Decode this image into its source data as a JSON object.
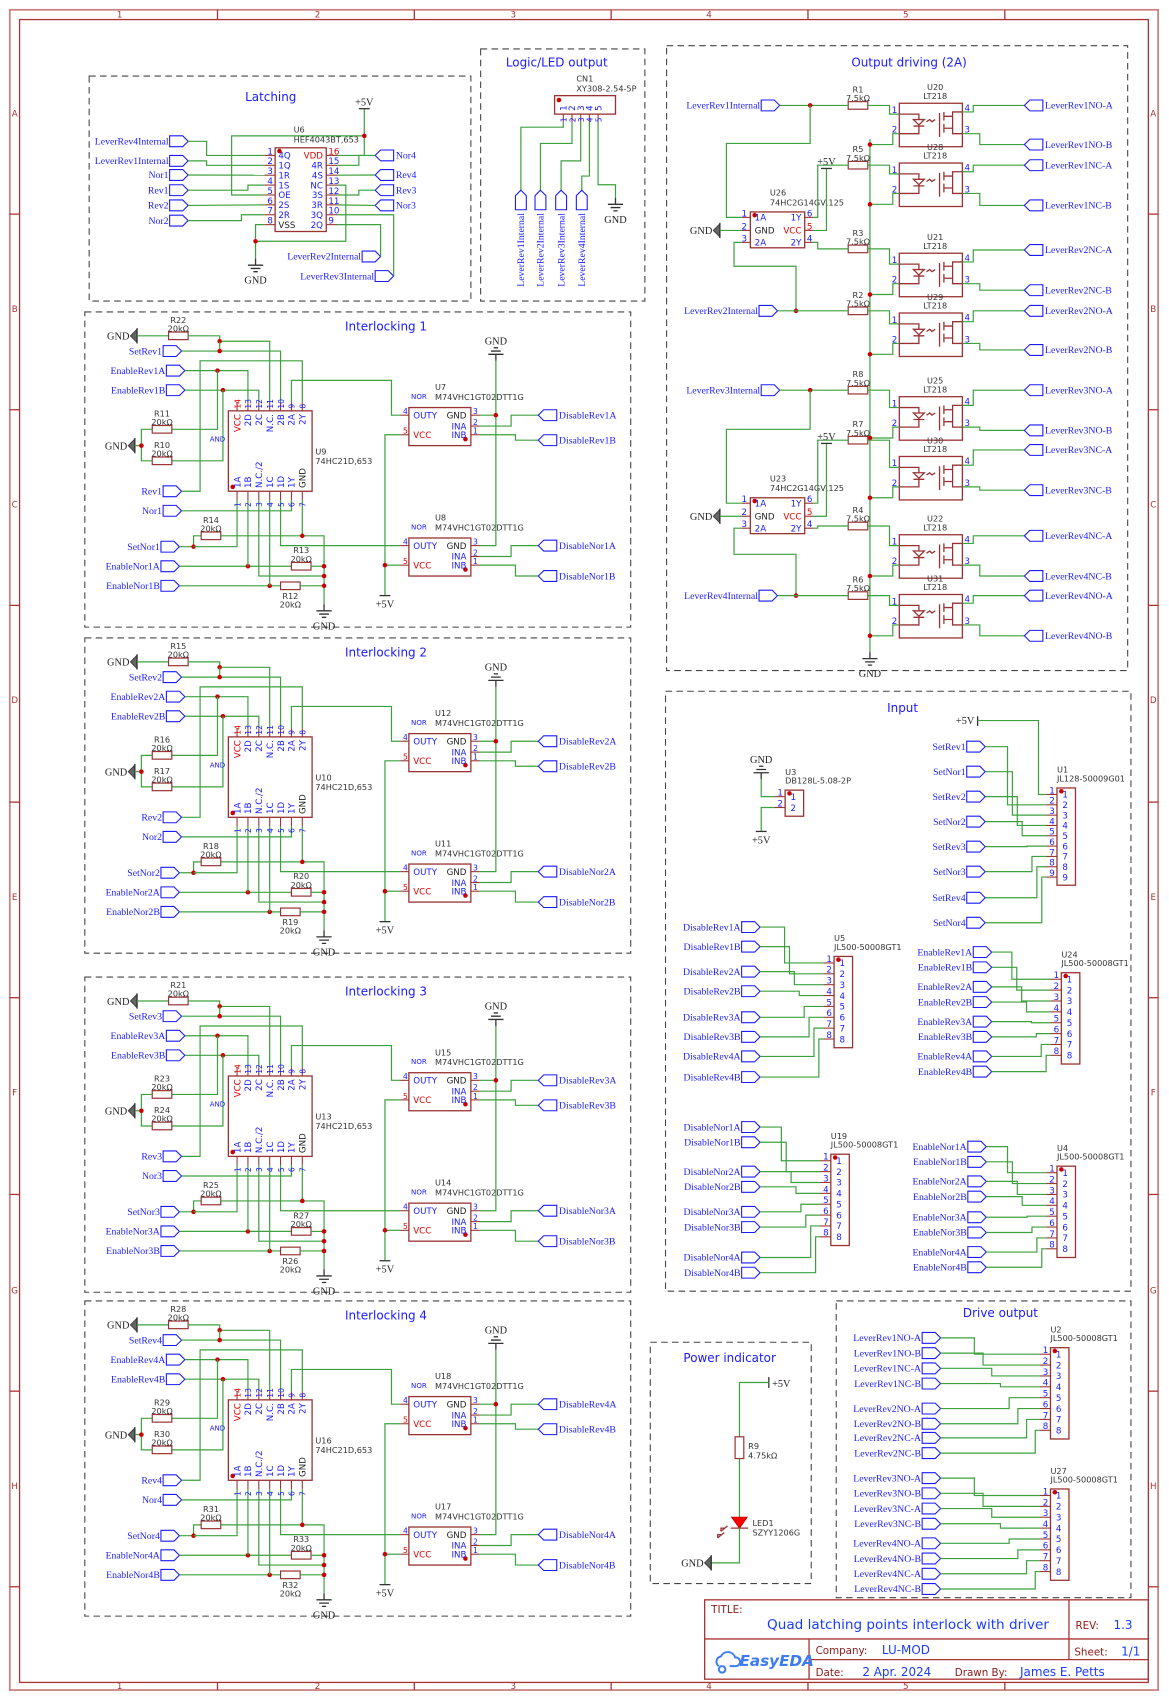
{
  "colors": {
    "wire": "#3ca03c",
    "net_flag": "#1a1aff",
    "component": "#993333",
    "junction": "#cc0000",
    "frame": "#aa3333",
    "led": "#ff0000"
  },
  "symbols": {
    "gnd": "GND",
    "vcc": "+5V"
  },
  "frame": {
    "columns": [
      "1",
      "2",
      "3",
      "4",
      "5"
    ],
    "rows": [
      "A",
      "B",
      "C",
      "D",
      "E",
      "F",
      "G",
      "H"
    ]
  },
  "latching": {
    "title": "Latching",
    "ref": "U6",
    "part": "HEF4043BT,653",
    "left_pins": [
      [
        "1",
        "4Q"
      ],
      [
        "2",
        "1Q"
      ],
      [
        "3",
        "1R"
      ],
      [
        "4",
        "1S"
      ],
      [
        "5",
        "OE"
      ],
      [
        "6",
        "2S"
      ],
      [
        "7",
        "2R"
      ],
      [
        "8",
        "VSS"
      ]
    ],
    "right_pins": [
      [
        "16",
        "VDD"
      ],
      [
        "15",
        "4R"
      ],
      [
        "14",
        "4S"
      ],
      [
        "13",
        "NC"
      ],
      [
        "12",
        "3S"
      ],
      [
        "11",
        "3R"
      ],
      [
        "10",
        "3Q"
      ],
      [
        "9",
        "2Q"
      ]
    ],
    "left_nets": [
      "LeverRev4Internal",
      "LeverRev1Internal",
      "Nor1",
      "Rev1",
      "Rev2",
      "Nor2"
    ],
    "right_nets": [
      "Nor4",
      "Rev4",
      "Rev3",
      "Nor3"
    ],
    "bottom_nets": [
      "LeverRev2Internal",
      "LeverRev3Internal"
    ]
  },
  "logic": {
    "title": "Logic/LED output",
    "ref": "CN1",
    "part": "XY308-2.54-5P",
    "pins": [
      "1",
      "2",
      "3",
      "4",
      "5"
    ],
    "nets": [
      "LeverRev1Internal",
      "LeverRev2Internal",
      "LeverRev3Internal",
      "LeverRev4Internal"
    ]
  },
  "interlocking": {
    "and_part": "74HC21D,653",
    "and_gate": "AND",
    "and_top_pins": [
      [
        "14",
        "VCC"
      ],
      [
        "13",
        "2D"
      ],
      [
        "12",
        "2C"
      ],
      [
        "11",
        "N.C."
      ],
      [
        "10",
        "2B"
      ],
      [
        "9",
        "2A"
      ],
      [
        "8",
        "2Y"
      ]
    ],
    "and_bottom_pins": [
      [
        "1",
        "1A"
      ],
      [
        "2",
        "1B"
      ],
      [
        "3",
        "N.C./2"
      ],
      [
        "4",
        "1C"
      ],
      [
        "5",
        "1D"
      ],
      [
        "6",
        "1Y"
      ],
      [
        "7",
        "GND"
      ]
    ],
    "nor_part": "M74VHC1GT02DTT1G",
    "nor_gate": "NOR",
    "nor_left_pins": [
      [
        "4",
        "OUTY"
      ],
      [
        "5",
        "VCC"
      ]
    ],
    "nor_right_pins": [
      [
        "3",
        "GND"
      ],
      [
        "2",
        "INA"
      ],
      [
        "1",
        "INB"
      ]
    ],
    "modules": [
      {
        "title": "Interlocking 1",
        "nets": [
          "SetRev1",
          "EnableRev1A",
          "EnableRev1B",
          "Rev1",
          "Nor1",
          "SetNor1",
          "EnableNor1A",
          "EnableNor1B"
        ],
        "outputs": [
          "DisableRev1A",
          "DisableRev1B",
          "DisableNor1A",
          "DisableNor1B"
        ],
        "resistors": [
          {
            "ref": "R22",
            "value": "20kΩ"
          },
          {
            "ref": "R11",
            "value": "20kΩ"
          },
          {
            "ref": "R10",
            "value": "20kΩ"
          },
          {
            "ref": "R14",
            "value": "20kΩ"
          },
          {
            "ref": "R13",
            "value": "20kΩ"
          },
          {
            "ref": "R12",
            "value": "20kΩ"
          }
        ],
        "and_ref": "U9",
        "nor_refs": [
          "U7",
          "U8"
        ]
      },
      {
        "title": "Interlocking 2",
        "nets": [
          "SetRev2",
          "EnableRev2A",
          "EnableRev2B",
          "Rev2",
          "Nor2",
          "SetNor2",
          "EnableNor2A",
          "EnableNor2B"
        ],
        "outputs": [
          "DisableRev2A",
          "DisableRev2B",
          "DisableNor2A",
          "DisableNor2B"
        ],
        "resistors": [
          {
            "ref": "R15",
            "value": "20kΩ"
          },
          {
            "ref": "R16",
            "value": "20kΩ"
          },
          {
            "ref": "R17",
            "value": "20kΩ"
          },
          {
            "ref": "R18",
            "value": "20kΩ"
          },
          {
            "ref": "R20",
            "value": "20kΩ"
          },
          {
            "ref": "R19",
            "value": "20kΩ"
          }
        ],
        "and_ref": "U10",
        "nor_refs": [
          "U12",
          "U11"
        ]
      },
      {
        "title": "Interlocking 3",
        "nets": [
          "SetRev3",
          "EnableRev3A",
          "EnableRev3B",
          "Rev3",
          "Nor3",
          "SetNor3",
          "EnableNor3A",
          "EnableNor3B"
        ],
        "outputs": [
          "DisableRev3A",
          "DisableRev3B",
          "DisableNor3A",
          "DisableNor3B"
        ],
        "resistors": [
          {
            "ref": "R21",
            "value": "20kΩ"
          },
          {
            "ref": "R23",
            "value": "20kΩ"
          },
          {
            "ref": "R24",
            "value": "20kΩ"
          },
          {
            "ref": "R25",
            "value": "20kΩ"
          },
          {
            "ref": "R27",
            "value": "20kΩ"
          },
          {
            "ref": "R26",
            "value": "20kΩ"
          }
        ],
        "and_ref": "U13",
        "nor_refs": [
          "U15",
          "U14"
        ]
      },
      {
        "title": "Interlocking 4",
        "nets": [
          "SetRev4",
          "EnableRev4A",
          "EnableRev4B",
          "Rev4",
          "Nor4",
          "SetNor4",
          "EnableNor4A",
          "EnableNor4B"
        ],
        "outputs": [
          "DisableRev4A",
          "DisableRev4B",
          "DisableNor4A",
          "DisableNor4B"
        ],
        "resistors": [
          {
            "ref": "R28",
            "value": "20kΩ"
          },
          {
            "ref": "R29",
            "value": "20kΩ"
          },
          {
            "ref": "R30",
            "value": "20kΩ"
          },
          {
            "ref": "R31",
            "value": "20kΩ"
          },
          {
            "ref": "R33",
            "value": "20kΩ"
          },
          {
            "ref": "R32",
            "value": "20kΩ"
          }
        ],
        "and_ref": "U16",
        "nor_refs": [
          "U18",
          "U17"
        ]
      }
    ]
  },
  "output_driving": {
    "title": "Output driving (2A)",
    "inverters": [
      {
        "ref": "U26",
        "part": "74HC2G14GV,125"
      },
      {
        "ref": "U23",
        "part": "74HC2G14GV,125"
      }
    ],
    "inverter_left_pins": [
      [
        "1",
        "1A"
      ],
      [
        "2",
        "GND"
      ],
      [
        "3",
        "2A"
      ]
    ],
    "inverter_right_pins": [
      [
        "6",
        "1Y"
      ],
      [
        "5",
        "VCC"
      ],
      [
        "4",
        "2Y"
      ]
    ],
    "inputs": [
      "LeverRev1Internal",
      "LeverRev2Internal",
      "LeverRev3Internal",
      "LeverRev4Internal"
    ],
    "opto_pins": [
      "1",
      "2",
      "4",
      "3"
    ],
    "channels": [
      {
        "res": "R1",
        "value": "7.5kΩ",
        "ref": "U20",
        "part": "LT218",
        "out_a": "LeverRev1NO-A",
        "out_b": "LeverRev1NO-B"
      },
      {
        "res": "R5",
        "value": "7.5kΩ",
        "ref": "U28",
        "part": "LT218",
        "out_a": "LeverRev1NC-A",
        "out_b": "LeverRev1NC-B"
      },
      {
        "res": "R3",
        "value": "7.5kΩ",
        "ref": "U21",
        "part": "LT218",
        "out_a": "LeverRev2NC-A",
        "out_b": "LeverRev2NC-B"
      },
      {
        "res": "R2",
        "value": "7.5kΩ",
        "ref": "U29",
        "part": "LT218",
        "out_a": "LeverRev2NO-A",
        "out_b": "LeverRev2NO-B"
      },
      {
        "res": "R8",
        "value": "7.5kΩ",
        "ref": "U25",
        "part": "LT218",
        "out_a": "LeverRev3NO-A",
        "out_b": "LeverRev3NO-B"
      },
      {
        "res": "R7",
        "value": "7.5kΩ",
        "ref": "U30",
        "part": "LT218",
        "out_a": "LeverRev3NC-A",
        "out_b": "LeverRev3NC-B"
      },
      {
        "res": "R4",
        "value": "7.5kΩ",
        "ref": "U22",
        "part": "LT218",
        "out_a": "LeverRev4NC-A",
        "out_b": "LeverRev4NC-B"
      },
      {
        "res": "R6",
        "value": "7.5kΩ",
        "ref": "U31",
        "part": "LT218",
        "out_a": "LeverRev4NO-A",
        "out_b": "LeverRev4NO-B"
      }
    ]
  },
  "input": {
    "title": "Input",
    "power_connector": {
      "ref": "U3",
      "part": "DB128L-5.08-2P",
      "pins": [
        "1",
        "2"
      ]
    },
    "connectors": [
      {
        "ref": "U1",
        "part": "JL128-50009G01",
        "pins": [
          "1",
          "2",
          "3",
          "4",
          "5",
          "6",
          "7",
          "8",
          "9"
        ],
        "nets": [
          "SetRev1",
          "SetNor1",
          "SetRev2",
          "SetNor2",
          "SetRev3",
          "SetNor3",
          "SetRev4",
          "SetNor4"
        ]
      },
      {
        "ref": "U5",
        "part": "JL500-50008GT1",
        "pins": [
          "1",
          "2",
          "3",
          "4",
          "5",
          "6",
          "7",
          "8"
        ],
        "nets": [
          "DisableRev1A",
          "DisableRev1B",
          "DisableRev2A",
          "DisableRev2B",
          "DisableRev3A",
          "DisableRev3B",
          "DisableRev4A",
          "DisableRev4B"
        ]
      },
      {
        "ref": "U24",
        "part": "JL500-50008GT1",
        "pins": [
          "1",
          "2",
          "3",
          "4",
          "5",
          "6",
          "7",
          "8"
        ],
        "nets": [
          "EnableRev1A",
          "EnableRev1B",
          "EnableRev2A",
          "EnableRev2B",
          "EnableRev3A",
          "EnableRev3B",
          "EnableRev4A",
          "EnableRev4B"
        ]
      },
      {
        "ref": "U19",
        "part": "JL500-50008GT1",
        "pins": [
          "1",
          "2",
          "3",
          "4",
          "5",
          "6",
          "7",
          "8"
        ],
        "nets": [
          "DisableNor1A",
          "DisableNor1B",
          "DisableNor2A",
          "DisableNor2B",
          "DisableNor3A",
          "DisableNor3B",
          "DisableNor4A",
          "DisableNor4B"
        ]
      },
      {
        "ref": "U4",
        "part": "JL500-50008GT1",
        "pins": [
          "1",
          "2",
          "3",
          "4",
          "5",
          "6",
          "7",
          "8"
        ],
        "nets": [
          "EnableNor1A",
          "EnableNor1B",
          "EnableNor2A",
          "EnableNor2B",
          "EnableNor3A",
          "EnableNor3B",
          "EnableNor4A",
          "EnableNor4B"
        ]
      }
    ]
  },
  "power_indicator": {
    "title": "Power indicator",
    "res": "R9",
    "res_value": "4.75kΩ",
    "led": "LED1",
    "led_part": "SZYY1206G"
  },
  "drive_output": {
    "title": "Drive output",
    "connectors": [
      {
        "ref": "U2",
        "part": "JL500-50008GT1",
        "pins": [
          "1",
          "2",
          "3",
          "4",
          "5",
          "6",
          "7",
          "8"
        ],
        "nets": [
          "LeverRev1NO-A",
          "LeverRev1NO-B",
          "LeverRev1NC-A",
          "LeverRev1NC-B",
          "LeverRev2NO-A",
          "LeverRev2NO-B",
          "LeverRev2NC-A",
          "LeverRev2NC-B"
        ]
      },
      {
        "ref": "U27",
        "part": "JL500-50008GT1",
        "pins": [
          "1",
          "2",
          "3",
          "4",
          "5",
          "6",
          "7",
          "8"
        ],
        "nets": [
          "LeverRev3NO-A",
          "LeverRev3NO-B",
          "LeverRev3NC-A",
          "LeverRev3NC-B",
          "LeverRev4NO-A",
          "LeverRev4NO-B",
          "LeverRev4NC-A",
          "LeverRev4NC-B"
        ]
      }
    ]
  },
  "title_block": {
    "title_label": "TITLE:",
    "title": "Quad latching points interlock with driver",
    "rev_label": "REV:",
    "rev": "1.3",
    "company_label": "Company:",
    "company": "LU-MOD",
    "sheet_label": "Sheet:",
    "sheet": "1/1",
    "date_label": "Date:",
    "date": "2 Apr. 2024",
    "drawn_by_label": "Drawn By:",
    "drawn_by": "James E. Petts",
    "logo": "EasyEDA"
  }
}
